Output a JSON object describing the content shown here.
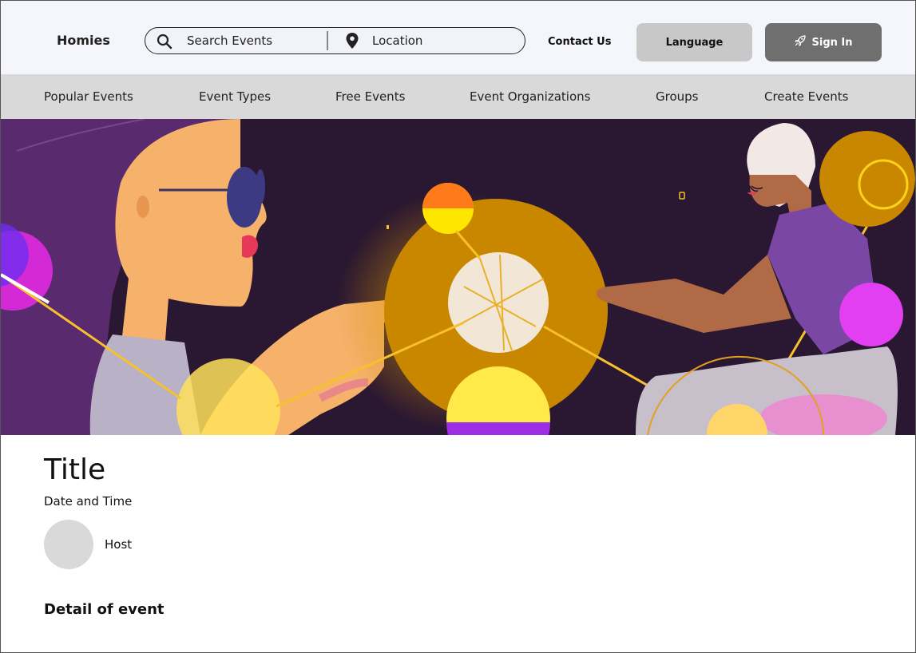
{
  "header": {
    "brand": "Homies",
    "search_placeholder": "Search Events",
    "location_placeholder": "Location",
    "contact_label": "Contact Us",
    "language_label": "Language",
    "signin_label": "Sign In"
  },
  "nav": {
    "items": [
      {
        "label": "Popular Events"
      },
      {
        "label": "Event Types"
      },
      {
        "label": "Free Events"
      },
      {
        "label": "Event Organizations"
      },
      {
        "label": "Groups"
      },
      {
        "label": "Create Events"
      }
    ]
  },
  "event": {
    "title": "Title",
    "date_time": "Date and Time",
    "host": "Host",
    "detail_heading": "Detail of event"
  },
  "icons": {
    "search": "search-icon",
    "location": "map-pin-icon",
    "signin": "rocket-icon"
  },
  "colors": {
    "header_bg": "#f4f6fc",
    "nav_bg": "#d9d9d9",
    "language_btn": "#c8c8c8",
    "signin_btn": "#6f6f6f",
    "hero_bg": "#2a1731"
  }
}
